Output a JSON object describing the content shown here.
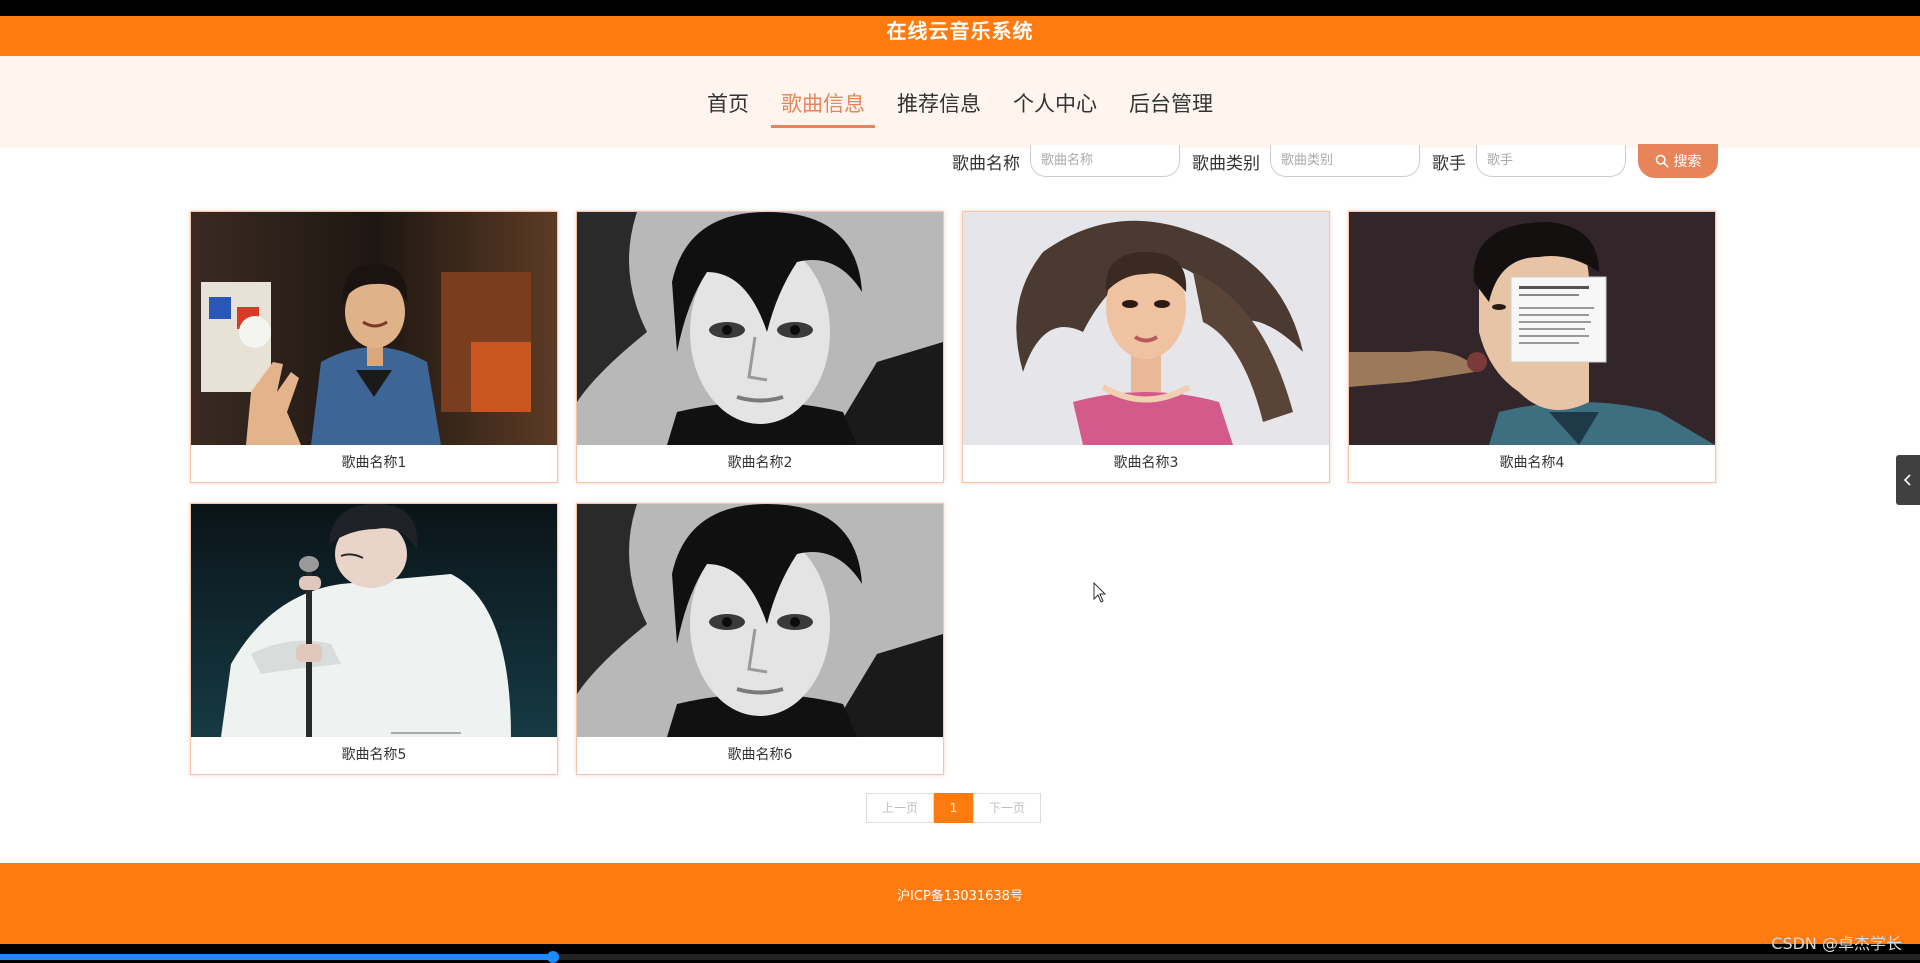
{
  "header": {
    "title": "在线云音乐系统"
  },
  "nav": {
    "items": [
      {
        "label": "首页",
        "active": false
      },
      {
        "label": "歌曲信息",
        "active": true
      },
      {
        "label": "推荐信息",
        "active": false
      },
      {
        "label": "个人中心",
        "active": false
      },
      {
        "label": "后台管理",
        "active": false
      }
    ]
  },
  "search": {
    "song_name_label": "歌曲名称",
    "song_name_placeholder": "歌曲名称",
    "song_type_label": "歌曲类别",
    "song_type_placeholder": "歌曲类别",
    "singer_label": "歌手",
    "singer_placeholder": "歌手",
    "button_label": "搜索"
  },
  "songs": [
    {
      "name": "歌曲名称1",
      "image": "photo-man-denim-peace-sign"
    },
    {
      "name": "歌曲名称2",
      "image": "photo-bw-portrait-dark-hair"
    },
    {
      "name": "歌曲名称3",
      "image": "photo-woman-pink-top-flowing-hair"
    },
    {
      "name": "歌曲名称4",
      "image": "photo-man-profile-with-note"
    },
    {
      "name": "歌曲名称5",
      "image": "photo-man-white-jacket-microphone"
    },
    {
      "name": "歌曲名称6",
      "image": "photo-bw-portrait-dark-hair"
    }
  ],
  "pagination": {
    "prev_label": "上一页",
    "current_page": "1",
    "next_label": "下一页"
  },
  "footer": {
    "icp": "沪ICP备13031638号"
  },
  "watermark": "CSDN @卓杰学长",
  "video_progress": 0.288,
  "colors": {
    "brand_orange": "#ff7a0f",
    "accent": "#e8845a",
    "nav_bg": "#fff5ee"
  }
}
